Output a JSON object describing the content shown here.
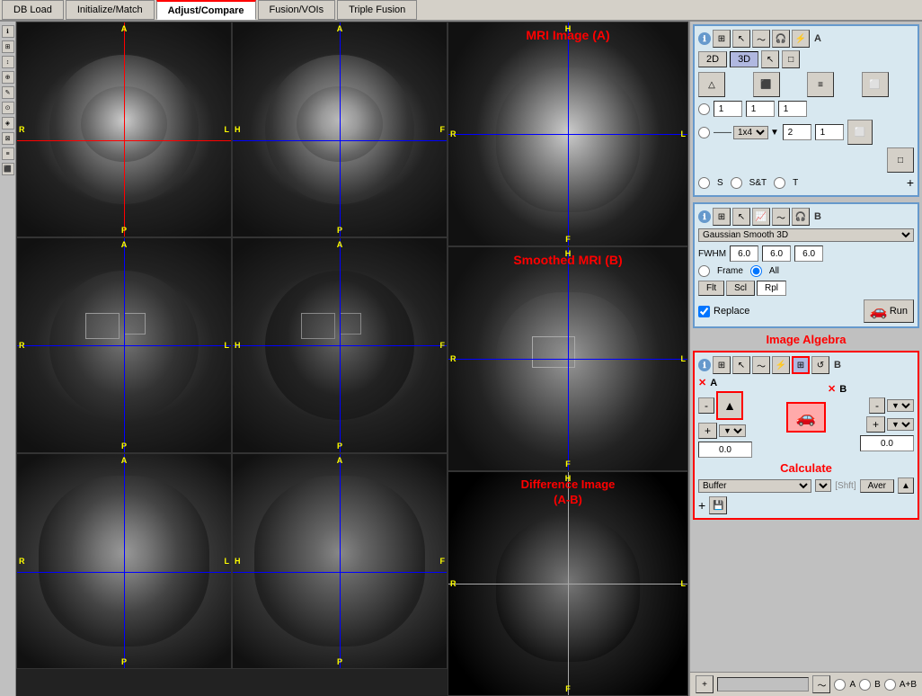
{
  "tabs": [
    {
      "id": "db-load",
      "label": "DB Load",
      "active": false
    },
    {
      "id": "initialize-match",
      "label": "Initialize/Match",
      "active": false
    },
    {
      "id": "adjust-compare",
      "label": "Adjust/Compare",
      "active": true
    },
    {
      "id": "fusion-vois",
      "label": "Fusion/VOIs",
      "active": false
    },
    {
      "id": "triple-fusion",
      "label": "Triple Fusion",
      "active": false
    }
  ],
  "images": {
    "row1": {
      "cell1": {
        "label": "axial-brain-top-left"
      },
      "cell2": {
        "label": "axial-brain-top-mid"
      }
    },
    "row2": {
      "cell1": {
        "label": "axial-brain-mid-left"
      },
      "cell2": {
        "label": "axial-brain-mid-mid"
      }
    },
    "row3": {
      "cell1": {
        "label": "axial-brain-bot-left"
      },
      "cell2": {
        "label": "axial-brain-bot-mid"
      }
    },
    "right_col": {
      "cell1": {
        "label": "MRI Image (A)"
      },
      "cell2": {
        "label": "Smoothed MRI (B)"
      },
      "cell3_line1": "Difference Image",
      "cell3_line2": "(A-B)"
    }
  },
  "directions": {
    "A": "A",
    "P": "P",
    "L": "L",
    "R": "R",
    "H": "H",
    "F": "F"
  },
  "right_panel": {
    "section1": {
      "letter": "A",
      "buttons": [
        "info",
        "grid",
        "cursor",
        "wave",
        "headphones",
        "plug"
      ],
      "view_btns": [
        "2D",
        "3D",
        "cursor",
        "square"
      ],
      "icon_grid": [
        "pyramid",
        "box",
        "layers",
        "cube"
      ],
      "radio_options": [
        "1",
        "1",
        "1"
      ],
      "dropdown_value": "1x4",
      "number_inputs": [
        "2",
        "1"
      ],
      "radio_row2": [
        "S",
        "S&T",
        "T"
      ],
      "plus_label": "+"
    },
    "section2": {
      "letter": "B",
      "buttons": [
        "info",
        "grid",
        "cursor",
        "chart",
        "wave",
        "headphones"
      ],
      "gaussian_label": "Gaussian Smooth 3D",
      "fwhm_label": "FWHM",
      "fwhm_values": [
        "6.0",
        "6.0",
        "6.0"
      ],
      "radio_options": [
        "Frame",
        "All"
      ],
      "tabs": [
        "Flt",
        "Scl",
        "Rpl"
      ],
      "active_tab": "Rpl",
      "checkbox_label": "Replace",
      "run_label": "Run"
    },
    "section3": {
      "title": "Image Algebra",
      "letter": "B",
      "col_a_label": "A",
      "col_b_label": "B",
      "minus": "-",
      "plus_a": "+",
      "plus_b": "+",
      "value_a": "0.0",
      "value_b": "0.0",
      "calculate_label": "Calculate",
      "buffer_label": "Buffer",
      "aver_label": "Aver",
      "shift_ctrl_label": "[Shft]",
      "plus_bottom": "+",
      "save_icon": "💾"
    }
  },
  "bottom_bar": {
    "radio_options": [
      "A",
      "B",
      "A+B"
    ]
  }
}
